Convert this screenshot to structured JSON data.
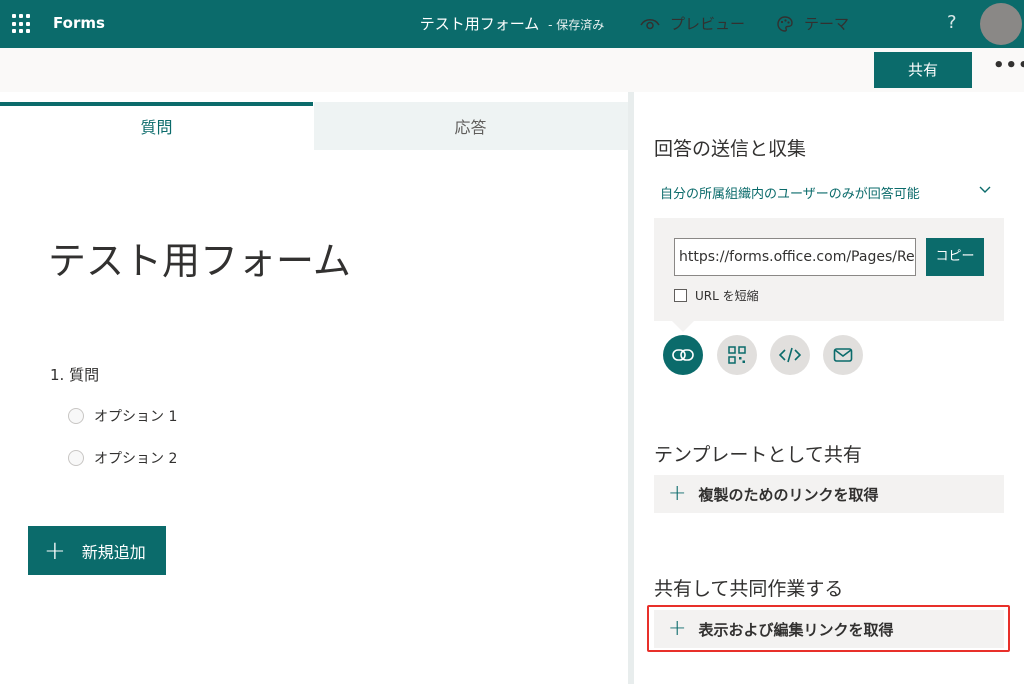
{
  "topbar": {
    "app_name": "Forms",
    "doc_title": "テスト用フォーム",
    "doc_status": "- 保存済み",
    "help": "?"
  },
  "commandbar": {
    "preview_label": "プレビュー",
    "theme_label": "テーマ",
    "share_label": "共有",
    "more_label": "•••"
  },
  "tabs": {
    "questions": "質問",
    "responses": "応答"
  },
  "form": {
    "title": "テスト用フォーム",
    "question": "1. 質問",
    "options": [
      "オプション 1",
      "オプション 2"
    ],
    "add_new": "新規追加"
  },
  "share_panel": {
    "send_title": "回答の送信と収集",
    "permission": "自分の所属組織内のユーザーのみが回答可能",
    "url_value": "https://forms.office.com/Pages/Re",
    "copy_label": "コピー",
    "shorten_label": "URL を短縮",
    "template_title": "テンプレートとして共有",
    "template_button": "複製のためのリンクを取得",
    "collab_title": "共有して共同作業する",
    "collab_button": "表示および編集リンクを取得"
  },
  "colors": {
    "brand": "#0b6b6b",
    "highlight": "#e8302a"
  },
  "icons": [
    "waffle-icon",
    "help-icon",
    "eye-icon",
    "palette-icon",
    "chevron-down-icon",
    "link-icon",
    "qr-code-icon",
    "embed-code-icon",
    "mail-icon",
    "plus-icon"
  ]
}
